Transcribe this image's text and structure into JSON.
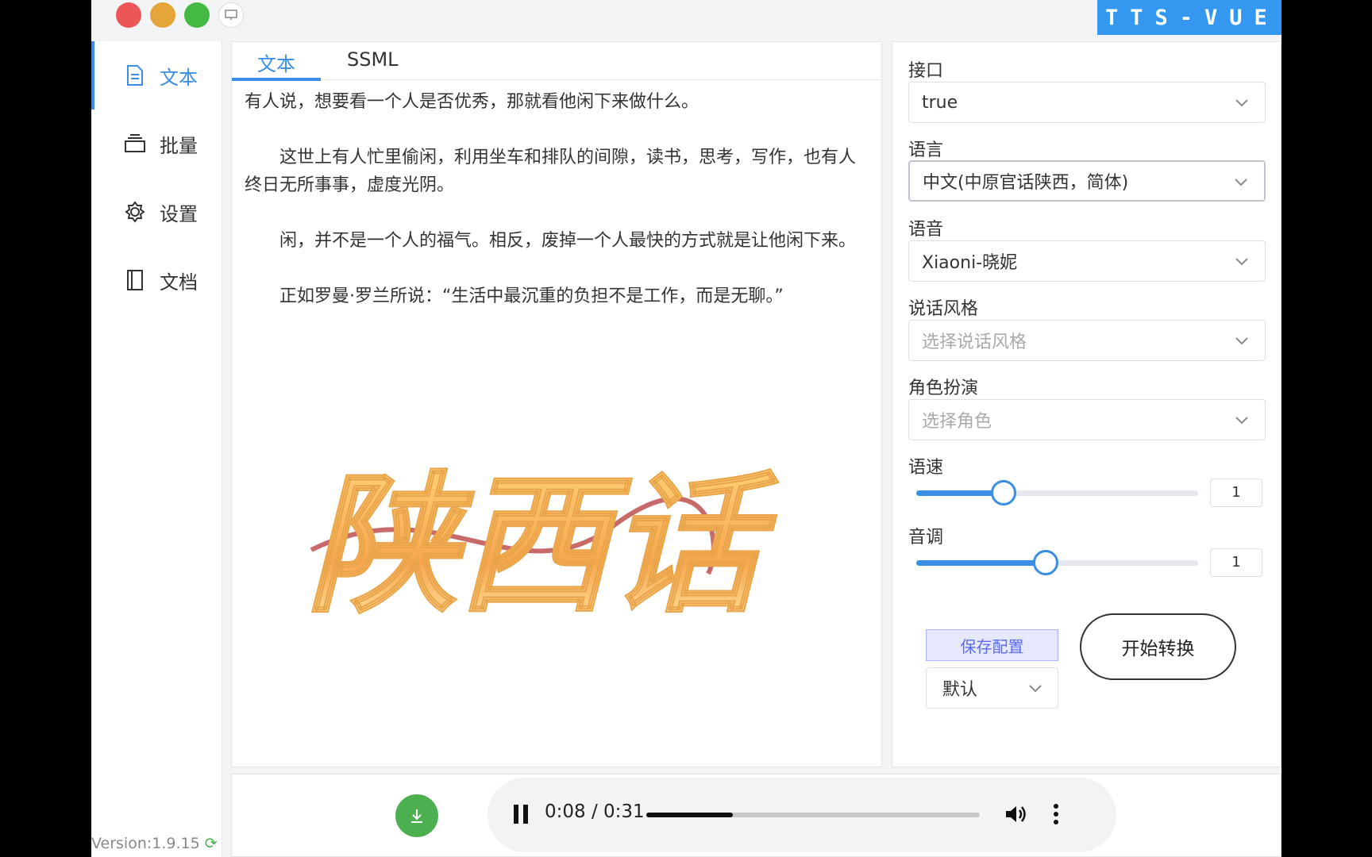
{
  "brand": "TTS-VUE",
  "sidebar": {
    "items": [
      {
        "label": "文本",
        "icon": "document-icon"
      },
      {
        "label": "批量",
        "icon": "stack-icon"
      },
      {
        "label": "设置",
        "icon": "gear-icon"
      },
      {
        "label": "文档",
        "icon": "book-icon"
      }
    ],
    "version": "Version:1.9.15"
  },
  "tabs": [
    "文本",
    "SSML"
  ],
  "editor": {
    "paragraphs": [
      "有人说，想要看一个人是否优秀，那就看他闲下来做什么。",
      "　　这世上有人忙里偷闲，利用坐车和排队的间隙，读书，思考，写作，也有人终日无所事事，虚度光阴。",
      "　　闲，并不是一个人的福气。相反，废掉一个人最快的方式就是让他闲下来。",
      "　　正如罗曼·罗兰所说：“生活中最沉重的负担不是工作，而是无聊。”"
    ]
  },
  "overlay_text": "陕西话",
  "settings": {
    "api": {
      "label": "接口",
      "value": "true"
    },
    "language": {
      "label": "语言",
      "value": "中文(中原官话陕西，简体)"
    },
    "voice": {
      "label": "语音",
      "value": "Xiaoni-晓妮"
    },
    "style": {
      "label": "说话风格",
      "placeholder": "选择说话风格"
    },
    "role": {
      "label": "角色扮演",
      "placeholder": "选择角色"
    },
    "rate": {
      "label": "语速",
      "value": "1",
      "fraction": 0.31
    },
    "pitch": {
      "label": "音调",
      "value": "1",
      "fraction": 0.46
    }
  },
  "save_config": "保存配置",
  "preset": "默认",
  "convert": "开始转换",
  "player": {
    "time": "0:08 / 0:31",
    "progress": 0.26
  },
  "colors": {
    "accent": "#3a8ee6",
    "brand": "#3598f0",
    "download": "#4caf50"
  }
}
